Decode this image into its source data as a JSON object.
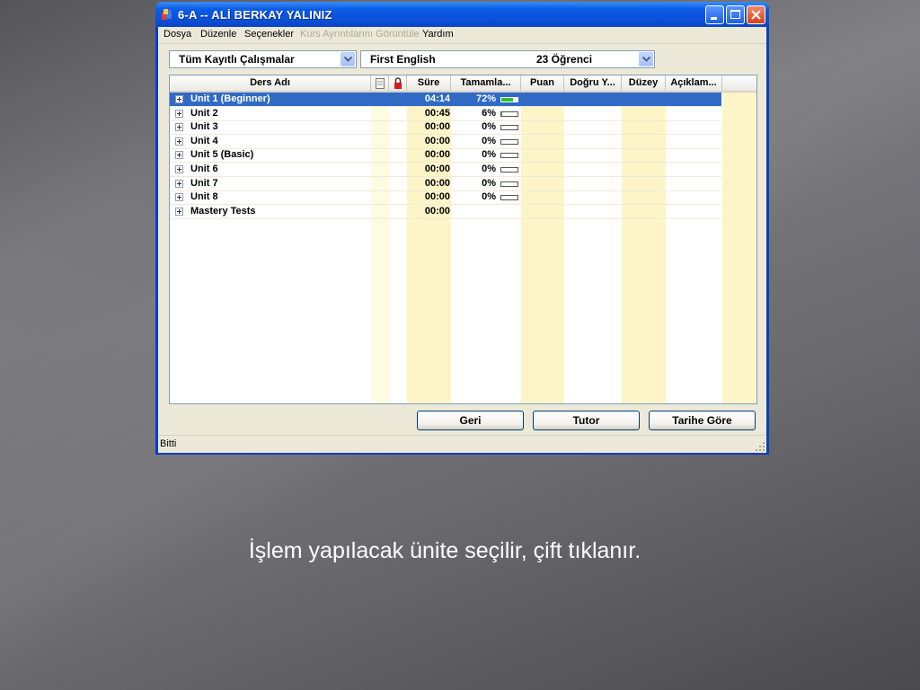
{
  "window": {
    "title": "6-A -- ALİ BERKAY YALINIZ"
  },
  "menu": [
    {
      "label": "Dosya",
      "enabled": true
    },
    {
      "label": "Düzenle",
      "enabled": true
    },
    {
      "label": "Seçenekler",
      "enabled": true
    },
    {
      "label": "Kurs Ayrıntılarını Görüntüle",
      "enabled": false
    },
    {
      "label": "Yardım",
      "enabled": true
    }
  ],
  "filters": {
    "works_combo": "Tüm Kayıtlı Çalışmalar",
    "course_combo": "First English",
    "student_count": "23 Öğrenci"
  },
  "columns": {
    "name": "Ders Adı",
    "notes_icon": "notes-icon",
    "lock_icon": "lock-icon",
    "time": "Süre",
    "completion": "Tamamla...",
    "score": "Puan",
    "correct": "Doğru Y...",
    "level": "Düzey",
    "description": "Açıklam..."
  },
  "rows": [
    {
      "name": "Unit 1 (Beginner)",
      "time": "04:14",
      "pct": "72%",
      "progress": 0.72,
      "selected": true
    },
    {
      "name": "Unit 2",
      "time": "00:45",
      "pct": "6%",
      "progress": 0.06
    },
    {
      "name": "Unit 3",
      "time": "00:00",
      "pct": "0%",
      "progress": 0
    },
    {
      "name": "Unit 4",
      "time": "00:00",
      "pct": "0%",
      "progress": 0
    },
    {
      "name": "Unit 5 (Basic)",
      "time": "00:00",
      "pct": "0%",
      "progress": 0
    },
    {
      "name": "Unit 6",
      "time": "00:00",
      "pct": "0%",
      "progress": 0
    },
    {
      "name": "Unit 7",
      "time": "00:00",
      "pct": "0%",
      "progress": 0
    },
    {
      "name": "Unit 8",
      "time": "00:00",
      "pct": "0%",
      "progress": 0
    },
    {
      "name": "Mastery Tests",
      "time": "00:00",
      "pct": "",
      "progress": null
    }
  ],
  "buttons": {
    "back": "Geri",
    "tutor": "Tutor",
    "by_date": "Tarihe Göre"
  },
  "status": "Bitti",
  "caption": "İşlem yapılacak ünite seçilir, çift tıklanır."
}
